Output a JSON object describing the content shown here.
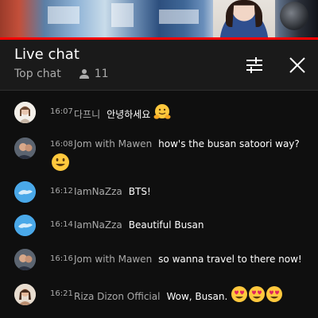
{
  "video": {
    "progress": 1.0
  },
  "header": {
    "title": "Live chat",
    "mode": "Top chat",
    "viewer_count": "11",
    "icons": {
      "viewers": "person-icon",
      "filter": "sliders-icon",
      "close": "close-icon"
    }
  },
  "colors": {
    "background": "#0f0f0f",
    "header": "#1a1a1a",
    "progress": "#ff0000",
    "muted": "#aaaaaa"
  },
  "messages": [
    {
      "time": "16:07",
      "author": "다프니",
      "text": "안녕하세요",
      "emoji": [
        "hugging-face"
      ],
      "avatar": "user-photo"
    },
    {
      "time": "16:08",
      "author": "Jom with Mawen",
      "text": "how's the busan satoori way?",
      "emoji": [
        "grinning-face"
      ],
      "avatar": "user-photo"
    },
    {
      "time": "16:12",
      "author": "IamNaZza",
      "text": "BTS!",
      "emoji": [],
      "avatar": "blue-avatar"
    },
    {
      "time": "16:14",
      "author": "IamNaZza",
      "text": "Beautiful Busan",
      "emoji": [],
      "avatar": "blue-avatar"
    },
    {
      "time": "16:16",
      "author": "Jom with Mawen",
      "text": "so wanna travel to there now!",
      "emoji": [],
      "avatar": "user-photo"
    },
    {
      "time": "16:21",
      "author": "Riza Dizon Official",
      "text": "Wow, Busan.",
      "emoji": [
        "heart-eyes-face",
        "heart-eyes-face",
        "heart-eyes-face"
      ],
      "avatar": "user-photo"
    }
  ]
}
